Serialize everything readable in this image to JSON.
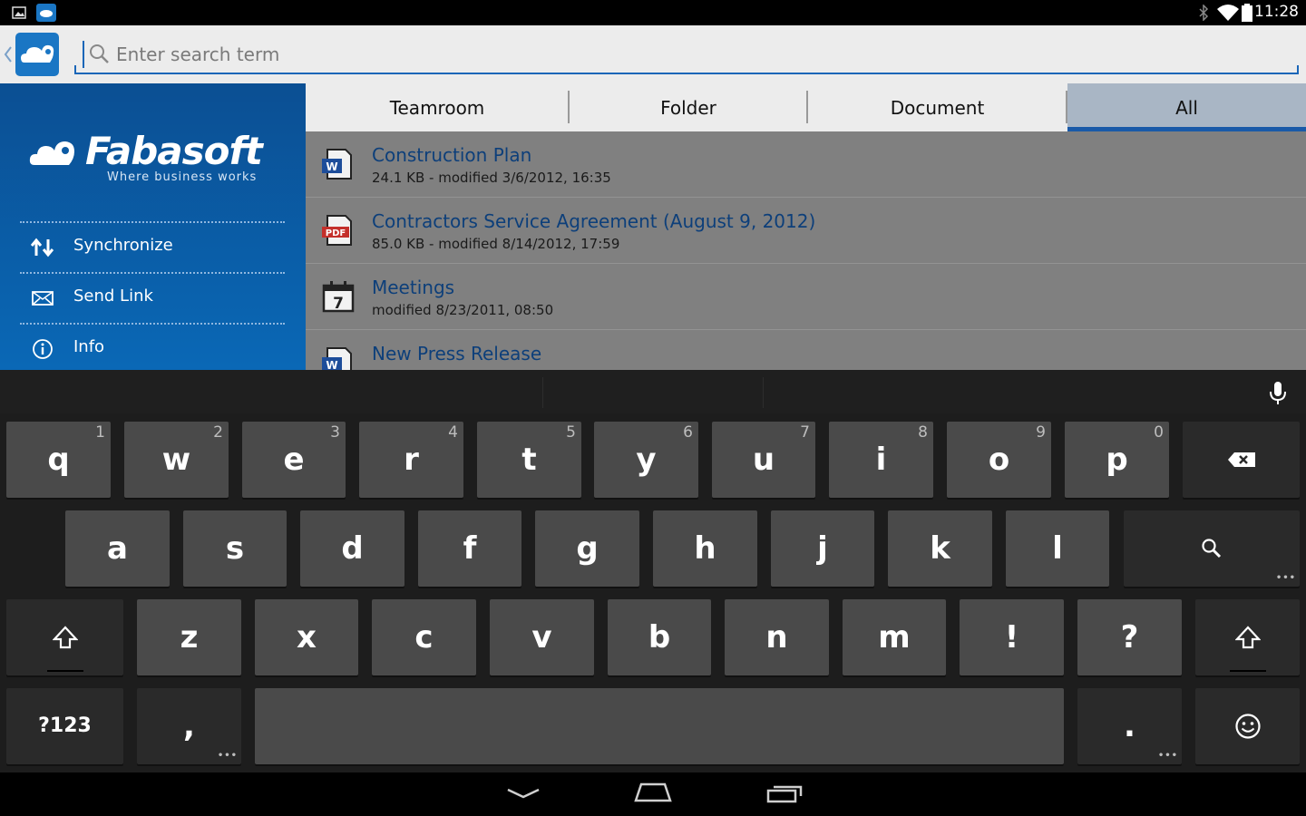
{
  "status_bar": {
    "time": "11:28"
  },
  "search": {
    "placeholder": "Enter search term"
  },
  "sidebar": {
    "logo_text": "Fabasoft",
    "tagline": "Where business works",
    "items": [
      {
        "label": "Synchronize",
        "icon": "sync-arrows-icon"
      },
      {
        "label": "Send Link",
        "icon": "envelope-icon"
      },
      {
        "label": "Info",
        "icon": "info-icon"
      }
    ]
  },
  "tabs": [
    {
      "label": "Teamroom",
      "selected": false
    },
    {
      "label": "Folder",
      "selected": false
    },
    {
      "label": "Document",
      "selected": false
    },
    {
      "label": "All",
      "selected": true
    }
  ],
  "documents": [
    {
      "title": "Construction Plan",
      "meta": "24.1 KB - modified 3/6/2012, 16:35",
      "icon": "word-document-icon"
    },
    {
      "title": "Contractors Service Agreement (August 9, 2012)",
      "meta": "85.0 KB - modified 8/14/2012, 17:59",
      "icon": "pdf-document-icon"
    },
    {
      "title": "Meetings",
      "meta": "modified 8/23/2011, 08:50",
      "icon": "calendar-icon"
    },
    {
      "title": "New Press Release",
      "meta": "",
      "icon": "word-document-icon"
    }
  ],
  "keyboard": {
    "row1": [
      {
        "key": "q",
        "hint": "1"
      },
      {
        "key": "w",
        "hint": "2"
      },
      {
        "key": "e",
        "hint": "3"
      },
      {
        "key": "r",
        "hint": "4"
      },
      {
        "key": "t",
        "hint": "5"
      },
      {
        "key": "y",
        "hint": "6"
      },
      {
        "key": "u",
        "hint": "7"
      },
      {
        "key": "i",
        "hint": "8"
      },
      {
        "key": "o",
        "hint": "9"
      },
      {
        "key": "p",
        "hint": "0"
      }
    ],
    "row2": [
      "a",
      "s",
      "d",
      "f",
      "g",
      "h",
      "j",
      "k",
      "l"
    ],
    "row3": [
      "z",
      "x",
      "c",
      "v",
      "b",
      "n",
      "m",
      "!",
      "?"
    ],
    "symbols_label": "?123",
    "comma": ",",
    "period": "."
  },
  "colors": {
    "sidebar_blue": "#0a68b6",
    "tab_selected": "#a9b6c5",
    "accent": "#1a5aa8",
    "list_bg": "#808080",
    "title_text": "#0d3f7a"
  }
}
